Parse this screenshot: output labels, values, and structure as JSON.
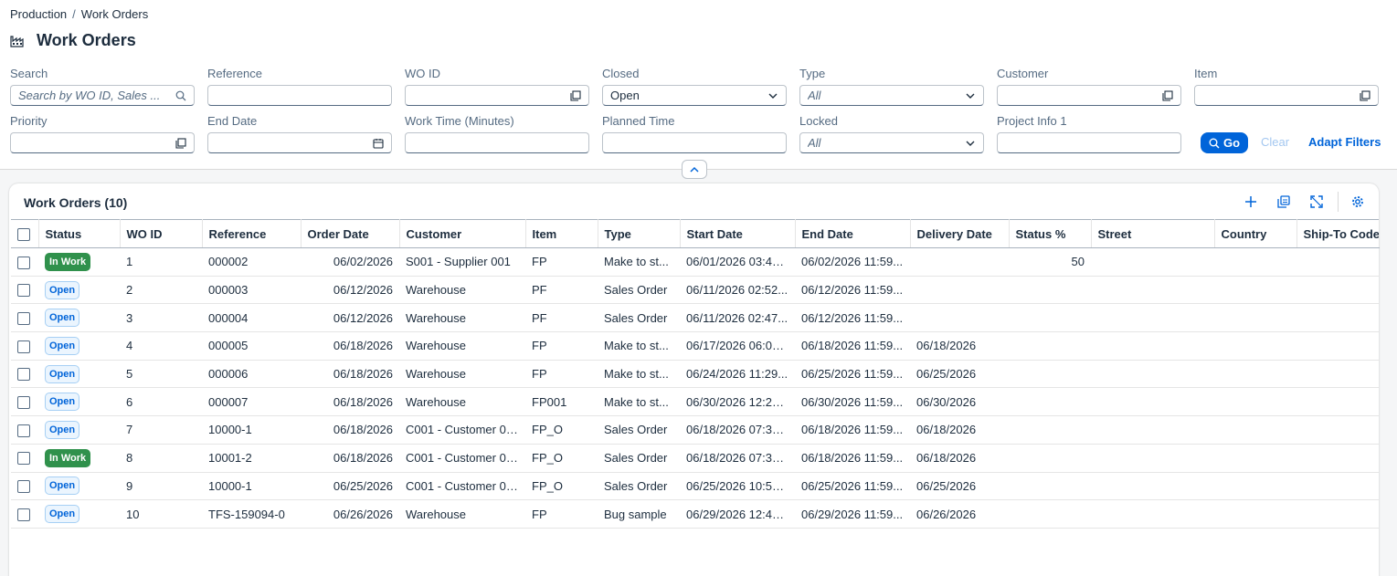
{
  "breadcrumb": [
    "Production",
    "Work Orders"
  ],
  "page": {
    "title": "Work Orders"
  },
  "filters": {
    "search": {
      "label": "Search",
      "placeholder": "Search by WO ID, Sales ..."
    },
    "reference": {
      "label": "Reference",
      "value": ""
    },
    "wo_id": {
      "label": "WO ID",
      "value": ""
    },
    "closed": {
      "label": "Closed",
      "value": "Open"
    },
    "type": {
      "label": "Type",
      "placeholder": "All"
    },
    "customer": {
      "label": "Customer",
      "value": ""
    },
    "item": {
      "label": "Item",
      "value": ""
    },
    "priority": {
      "label": "Priority",
      "value": ""
    },
    "end_date": {
      "label": "End Date",
      "value": ""
    },
    "work_time": {
      "label": "Work Time (Minutes)",
      "value": ""
    },
    "planned_time": {
      "label": "Planned Time",
      "value": ""
    },
    "locked": {
      "label": "Locked",
      "placeholder": "All"
    },
    "project_info": {
      "label": "Project Info 1",
      "value": ""
    },
    "go_label": "Go",
    "clear_label": "Clear",
    "adapt_label": "Adapt Filters"
  },
  "table": {
    "title": "Work Orders (10)",
    "columns": [
      "Status",
      "WO ID",
      "Reference",
      "Order Date",
      "Customer",
      "Item",
      "Type",
      "Start Date",
      "End Date",
      "Delivery Date",
      "Status %",
      "Street",
      "Country",
      "Ship-To Code"
    ],
    "rows": [
      {
        "status": "In Work",
        "status_kind": "inwork",
        "wo_id": "1",
        "reference": "000002",
        "order_date": "06/02/2026",
        "customer": "S001 - Supplier 001",
        "item": "FP",
        "type": "Make to st...",
        "start": "06/01/2026 03:40...",
        "end": "06/02/2026 11:59...",
        "delivery": "",
        "status_pct": "50",
        "street": "",
        "country": "",
        "ship_to": ""
      },
      {
        "status": "Open",
        "status_kind": "open",
        "wo_id": "2",
        "reference": "000003",
        "order_date": "06/12/2026",
        "customer": "Warehouse",
        "item": "PF",
        "type": "Sales Order",
        "start": "06/11/2026 02:52...",
        "end": "06/12/2026 11:59...",
        "delivery": "",
        "status_pct": "",
        "street": "",
        "country": "",
        "ship_to": ""
      },
      {
        "status": "Open",
        "status_kind": "open",
        "wo_id": "3",
        "reference": "000004",
        "order_date": "06/12/2026",
        "customer": "Warehouse",
        "item": "PF",
        "type": "Sales Order",
        "start": "06/11/2026 02:47...",
        "end": "06/12/2026 11:59...",
        "delivery": "",
        "status_pct": "",
        "street": "",
        "country": "",
        "ship_to": ""
      },
      {
        "status": "Open",
        "status_kind": "open",
        "wo_id": "4",
        "reference": "000005",
        "order_date": "06/18/2026",
        "customer": "Warehouse",
        "item": "FP",
        "type": "Make to st...",
        "start": "06/17/2026 06:09...",
        "end": "06/18/2026 11:59...",
        "delivery": "06/18/2026",
        "status_pct": "",
        "street": "",
        "country": "",
        "ship_to": ""
      },
      {
        "status": "Open",
        "status_kind": "open",
        "wo_id": "5",
        "reference": "000006",
        "order_date": "06/18/2026",
        "customer": "Warehouse",
        "item": "FP",
        "type": "Make to st...",
        "start": "06/24/2026 11:29...",
        "end": "06/25/2026 11:59...",
        "delivery": "06/25/2026",
        "status_pct": "",
        "street": "",
        "country": "",
        "ship_to": ""
      },
      {
        "status": "Open",
        "status_kind": "open",
        "wo_id": "6",
        "reference": "000007",
        "order_date": "06/18/2026",
        "customer": "Warehouse",
        "item": "FP001",
        "type": "Make to st...",
        "start": "06/30/2026 12:23...",
        "end": "06/30/2026 11:59...",
        "delivery": "06/30/2026",
        "status_pct": "",
        "street": "",
        "country": "",
        "ship_to": ""
      },
      {
        "status": "Open",
        "status_kind": "open",
        "wo_id": "7",
        "reference": "10000-1",
        "order_date": "06/18/2026",
        "customer": "C001 - Customer 001",
        "item": "FP_O",
        "type": "Sales Order",
        "start": "06/18/2026 07:30...",
        "end": "06/18/2026 11:59...",
        "delivery": "06/18/2026",
        "status_pct": "",
        "street": "",
        "country": "",
        "ship_to": ""
      },
      {
        "status": "In Work",
        "status_kind": "inwork",
        "wo_id": "8",
        "reference": "10001-2",
        "order_date": "06/18/2026",
        "customer": "C001 - Customer 001",
        "item": "FP_O",
        "type": "Sales Order",
        "start": "06/18/2026 07:30...",
        "end": "06/18/2026 11:59...",
        "delivery": "06/18/2026",
        "status_pct": "",
        "street": "",
        "country": "",
        "ship_to": ""
      },
      {
        "status": "Open",
        "status_kind": "open",
        "wo_id": "9",
        "reference": "10000-1",
        "order_date": "06/25/2026",
        "customer": "C001 - Customer 001",
        "item": "FP_O",
        "type": "Sales Order",
        "start": "06/25/2026 10:58...",
        "end": "06/25/2026 11:59...",
        "delivery": "06/25/2026",
        "status_pct": "",
        "street": "",
        "country": "",
        "ship_to": ""
      },
      {
        "status": "Open",
        "status_kind": "open",
        "wo_id": "10",
        "reference": "TFS-159094-0",
        "order_date": "06/26/2026",
        "customer": "Warehouse",
        "item": "FP",
        "type": "Bug sample",
        "start": "06/29/2026 12:45...",
        "end": "06/29/2026 11:59...",
        "delivery": "06/26/2026",
        "status_pct": "",
        "street": "",
        "country": "",
        "ship_to": ""
      }
    ]
  },
  "colors": {
    "accent": "#0064d9",
    "inwork": "#30914c",
    "open_bg": "#ebf5fe"
  }
}
